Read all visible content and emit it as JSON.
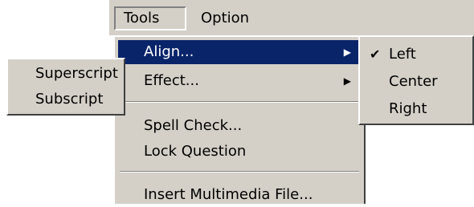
{
  "menubar": {
    "tools": "Tools",
    "option": "Option"
  },
  "tools_menu": {
    "items": [
      {
        "label": "Align...",
        "submenu": true
      },
      {
        "label": "Effect...",
        "submenu": true
      },
      {
        "label": "Spell Check..."
      },
      {
        "label": "Lock Question"
      },
      {
        "label": "Insert Multimedia File..."
      }
    ],
    "arrow_glyph": "▶"
  },
  "align_submenu": {
    "check_glyph": "✔",
    "items": [
      {
        "label": "Left",
        "checked": true
      },
      {
        "label": "Center"
      },
      {
        "label": "Right"
      }
    ]
  },
  "effect_submenu": {
    "items": [
      {
        "label": "Superscript"
      },
      {
        "label": "Subscript"
      }
    ]
  },
  "colors": {
    "menu_bg": "#d4d0c8",
    "highlight": "#0a246a",
    "highlight_text": "#ffffff"
  }
}
